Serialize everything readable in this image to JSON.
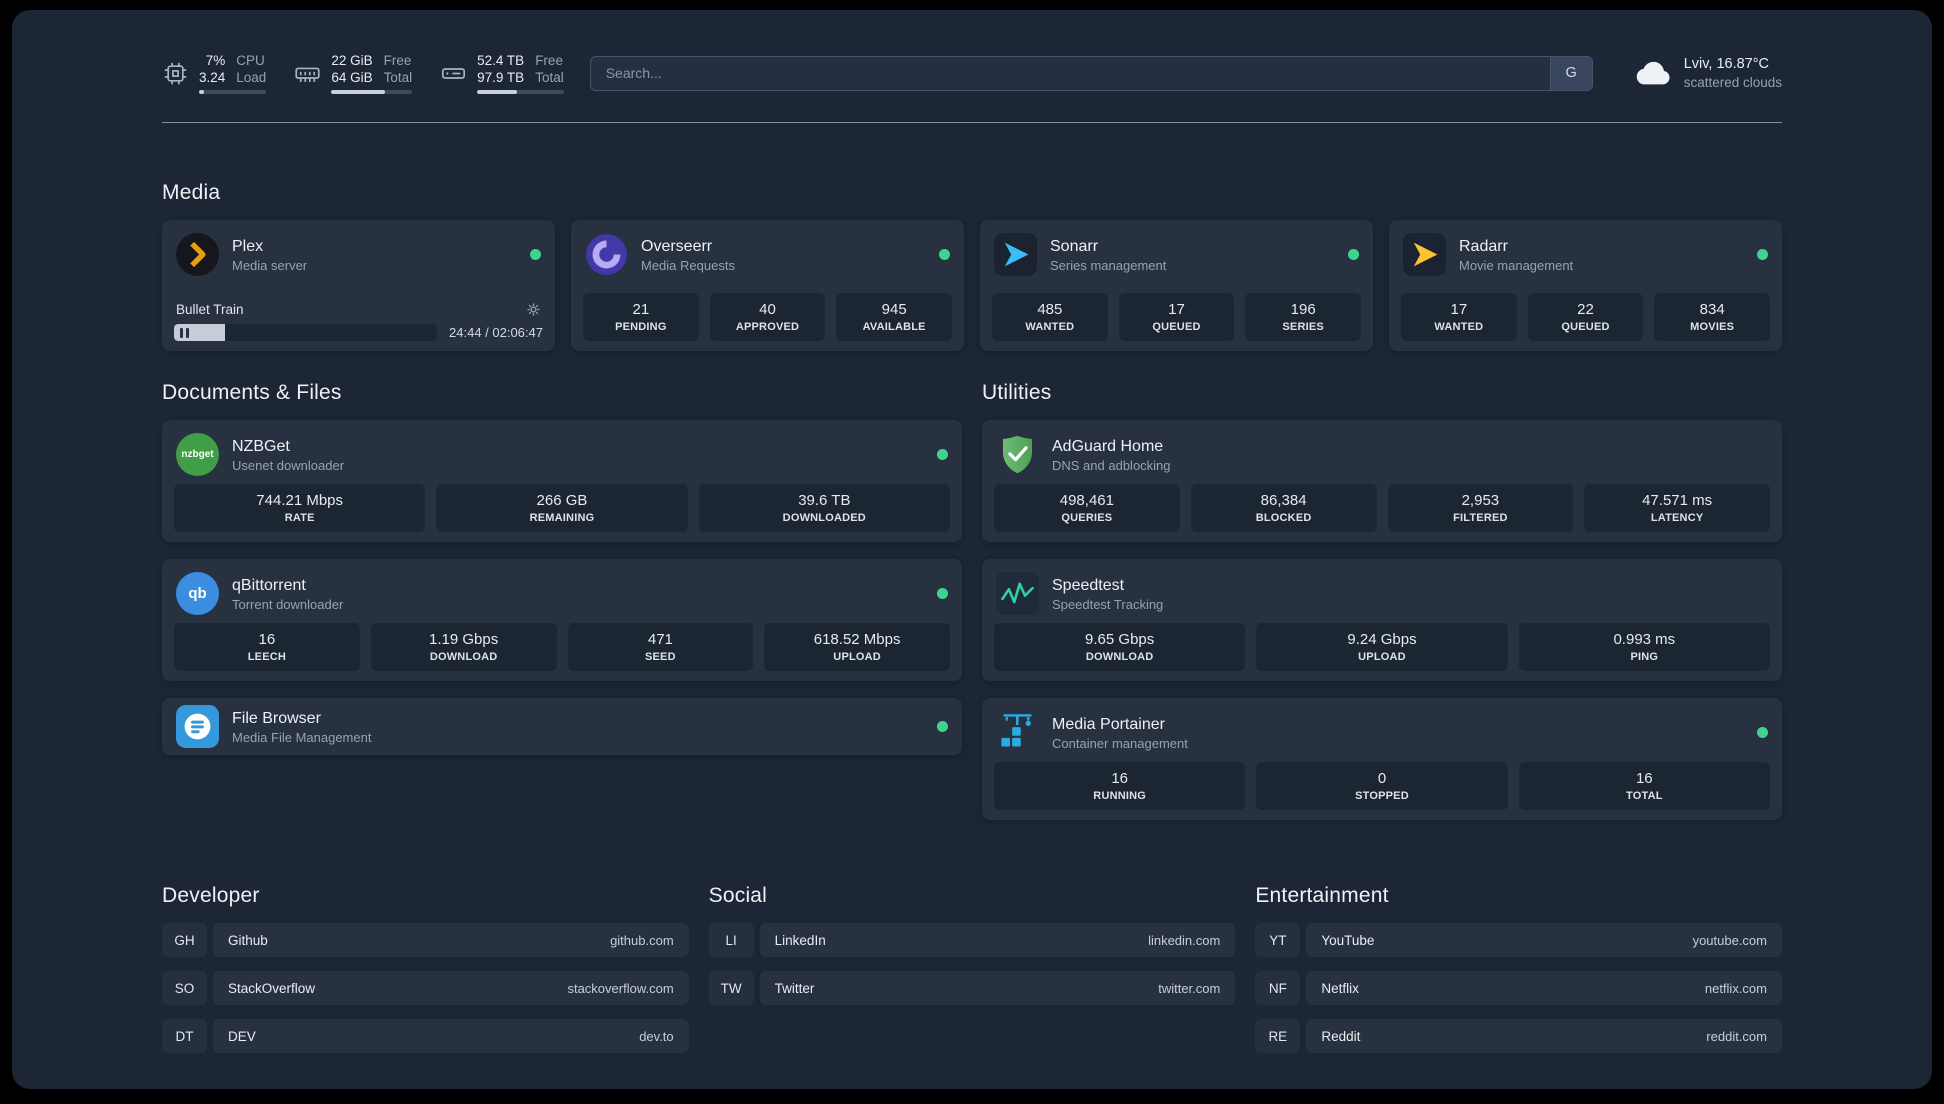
{
  "topbar": {
    "cpu": {
      "value_top": "7%",
      "value_bottom": "3.24",
      "label_top": "CPU",
      "label_bottom": "Load",
      "bar_percent": 7
    },
    "memory": {
      "value_top": "22 GiB",
      "value_bottom": "64 GiB",
      "label_top": "Free",
      "label_bottom": "Total",
      "bar_percent": 66
    },
    "disk": {
      "value_top": "52.4 TB",
      "value_bottom": "97.9 TB",
      "label_top": "Free",
      "label_bottom": "Total",
      "bar_percent": 46
    },
    "search": {
      "placeholder": "Search...",
      "provider_label": "G"
    },
    "weather": {
      "location": "Lviv, 16.87°C",
      "condition": "scattered clouds"
    }
  },
  "media": {
    "title": "Media",
    "plex": {
      "name": "Plex",
      "desc": "Media server",
      "now_playing": {
        "title": "Bullet Train",
        "time": "24:44 / 02:06:47",
        "progress_percent": 19.5
      }
    },
    "services": [
      {
        "name": "Overseerr",
        "desc": "Media Requests",
        "stats": [
          {
            "value": "21",
            "label": "PENDING"
          },
          {
            "value": "40",
            "label": "APPROVED"
          },
          {
            "value": "945",
            "label": "AVAILABLE"
          }
        ]
      },
      {
        "name": "Sonarr",
        "desc": "Series management",
        "stats": [
          {
            "value": "485",
            "label": "WANTED"
          },
          {
            "value": "17",
            "label": "QUEUED"
          },
          {
            "value": "196",
            "label": "SERIES"
          }
        ]
      },
      {
        "name": "Radarr",
        "desc": "Movie management",
        "stats": [
          {
            "value": "17",
            "label": "WANTED"
          },
          {
            "value": "22",
            "label": "QUEUED"
          },
          {
            "value": "834",
            "label": "MOVIES"
          }
        ]
      }
    ]
  },
  "documents": {
    "title": "Documents & Files",
    "services": [
      {
        "name": "NZBGet",
        "desc": "Usenet downloader",
        "icon_label": "nzbget",
        "stats": [
          {
            "value": "744.21 Mbps",
            "label": "RATE"
          },
          {
            "value": "266 GB",
            "label": "REMAINING"
          },
          {
            "value": "39.6 TB",
            "label": "DOWNLOADED"
          }
        ]
      },
      {
        "name": "qBittorrent",
        "desc": "Torrent downloader",
        "icon_label": "qb",
        "stats": [
          {
            "value": "16",
            "label": "LEECH"
          },
          {
            "value": "1.19 Gbps",
            "label": "DOWNLOAD"
          },
          {
            "value": "471",
            "label": "SEED"
          },
          {
            "value": "618.52 Mbps",
            "label": "UPLOAD"
          }
        ]
      },
      {
        "name": "File Browser",
        "desc": "Media File Management",
        "stats": []
      }
    ]
  },
  "utilities": {
    "title": "Utilities",
    "services": [
      {
        "name": "AdGuard Home",
        "desc": "DNS and adblocking",
        "stats": [
          {
            "value": "498,461",
            "label": "QUERIES"
          },
          {
            "value": "86,384",
            "label": "BLOCKED"
          },
          {
            "value": "2,953",
            "label": "FILTERED"
          },
          {
            "value": "47.571 ms",
            "label": "LATENCY"
          }
        ]
      },
      {
        "name": "Speedtest",
        "desc": "Speedtest Tracking",
        "stats": [
          {
            "value": "9.65 Gbps",
            "label": "DOWNLOAD"
          },
          {
            "value": "9.24 Gbps",
            "label": "UPLOAD"
          },
          {
            "value": "0.993 ms",
            "label": "PING"
          }
        ]
      },
      {
        "name": "Media Portainer",
        "desc": "Container management",
        "stats": [
          {
            "value": "16",
            "label": "RUNNING"
          },
          {
            "value": "0",
            "label": "STOPPED"
          },
          {
            "value": "16",
            "label": "TOTAL"
          }
        ]
      }
    ]
  },
  "bookmarks": [
    {
      "title": "Developer",
      "items": [
        {
          "abbr": "GH",
          "name": "Github",
          "domain": "github.com"
        },
        {
          "abbr": "SO",
          "name": "StackOverflow",
          "domain": "stackoverflow.com"
        },
        {
          "abbr": "DT",
          "name": "DEV",
          "domain": "dev.to"
        }
      ]
    },
    {
      "title": "Social",
      "items": [
        {
          "abbr": "LI",
          "name": "LinkedIn",
          "domain": "linkedin.com"
        },
        {
          "abbr": "TW",
          "name": "Twitter",
          "domain": "twitter.com"
        }
      ]
    },
    {
      "title": "Entertainment",
      "items": [
        {
          "abbr": "YT",
          "name": "YouTube",
          "domain": "youtube.com"
        },
        {
          "abbr": "NF",
          "name": "Netflix",
          "domain": "netflix.com"
        },
        {
          "abbr": "RE",
          "name": "Reddit",
          "domain": "reddit.com"
        }
      ]
    }
  ],
  "colors": {
    "status_green": "#3ed48f",
    "plex_gold": "#e5a00d",
    "sonarr_blue": "#38bdf8",
    "radarr_amber": "#ffc230"
  }
}
